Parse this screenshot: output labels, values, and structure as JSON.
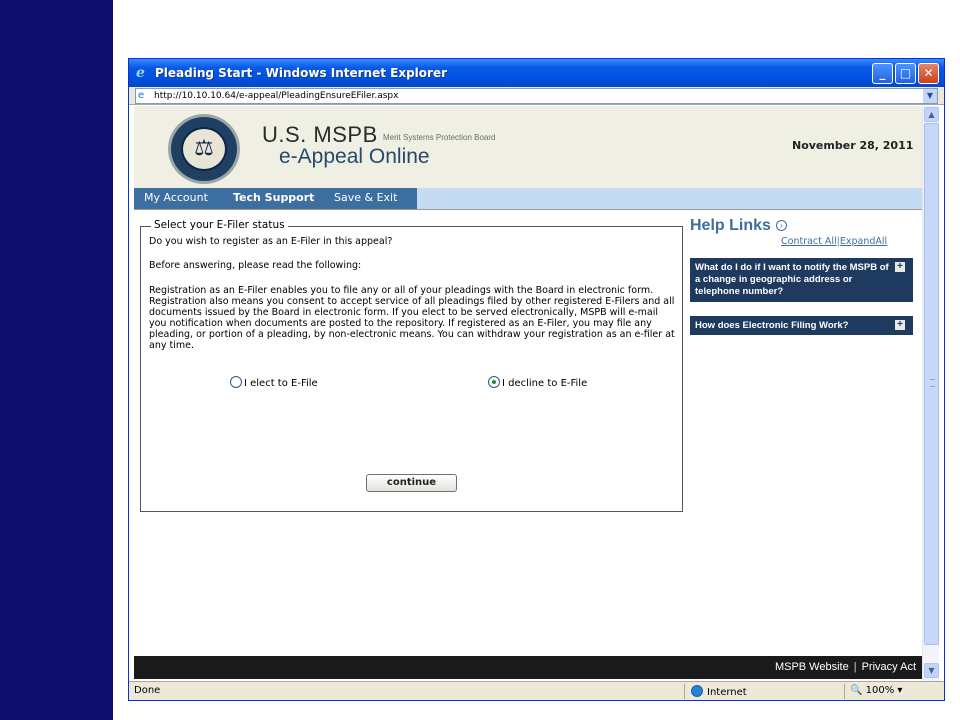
{
  "window": {
    "title": "Pleading Start - Windows Internet Explorer",
    "address": "http://10.10.10.64/e-appeal/PleadingEnsureEFiler.aspx"
  },
  "header": {
    "brand_name": "U.S. MSPB",
    "brand_sub": "Merit Systems Protection Board",
    "product": "e-Appeal Online",
    "date": "November 28, 2011"
  },
  "nav": {
    "my_account": "My Account",
    "tech_support": "Tech Support",
    "save_exit": "Save & Exit"
  },
  "form": {
    "legend": "Select your E-Filer status",
    "question": "Do you wish to register as an E-Filer in this appeal?",
    "before": "Before answering, please read the following:",
    "registration_text": "Registration as an E-Filer enables you to file any or all of your pleadings with the Board in electronic form. Registration also means you consent to accept service of all pleadings filed by other registered E-Filers and all documents issued by the Board in electronic form. If you elect to be served electronically, MSPB will e-mail you notification when documents are posted to the repository. If registered as an E-Filer, you may file any pleading, or portion of a pleading, by non-electronic means. You can withdraw your registration as an e-filer at any time.",
    "option_elect": "I elect to E-File",
    "option_decline": "I decline to E-File",
    "selected": "decline",
    "continue_label": "continue"
  },
  "help": {
    "title": "Help Links",
    "contract_all": "Contract All",
    "separator": "|",
    "expand_all": "ExpandAll",
    "items": [
      "What do I do if I want to notify the MSPB of a change in geographic address or telephone number?",
      "How does Electronic Filing Work?"
    ]
  },
  "footer": {
    "website": "MSPB Website",
    "separator": "|",
    "privacy": "Privacy Act"
  },
  "status": {
    "done": "Done",
    "zone": "Internet",
    "zoom": "100%"
  }
}
